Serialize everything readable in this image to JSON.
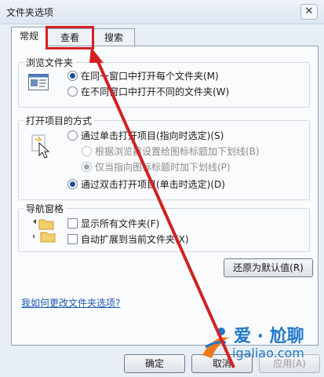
{
  "window": {
    "title": "文件夹选项",
    "close_symbol": "✕"
  },
  "tabs": [
    {
      "label": "常规",
      "active": true
    },
    {
      "label": "查看",
      "active": false
    },
    {
      "label": "搜索",
      "active": false
    }
  ],
  "browse_group": {
    "label": "浏览文件夹",
    "options": [
      {
        "label": "在同一窗口中打开每个文件夹(M)",
        "checked": true
      },
      {
        "label": "在不同窗口中打开不同的文件夹(W)",
        "checked": false
      }
    ]
  },
  "click_group": {
    "label": "打开项目的方式",
    "options": [
      {
        "label": "通过单击打开项目(指向时选定)(S)",
        "checked": false,
        "enabled": true
      },
      {
        "label": "根据浏览器设置给图标标题加下划线(B)",
        "checked": false,
        "enabled": false
      },
      {
        "label": "仅当指向图标标题时加下划线(P)",
        "checked": true,
        "enabled": false
      },
      {
        "label": "通过双击打开项目(单击时选定)(D)",
        "checked": true,
        "enabled": true
      }
    ]
  },
  "nav_group": {
    "label": "导航窗格",
    "options": [
      {
        "label": "显示所有文件夹(F)",
        "checked": false
      },
      {
        "label": "自动扩展到当前文件夹(X)",
        "checked": false
      }
    ]
  },
  "buttons": {
    "restore": "还原为默认值(R)",
    "ok": "确定",
    "cancel": "取消",
    "apply": "应用(A)"
  },
  "help_link": "我如何更改文件夹选项?",
  "watermark": {
    "line1": "爱 · 尬聊",
    "line2": "igaliao.com"
  },
  "colors": {
    "highlight": "#d42020",
    "link": "#1c57b5",
    "watermark": "#1f78c9"
  }
}
